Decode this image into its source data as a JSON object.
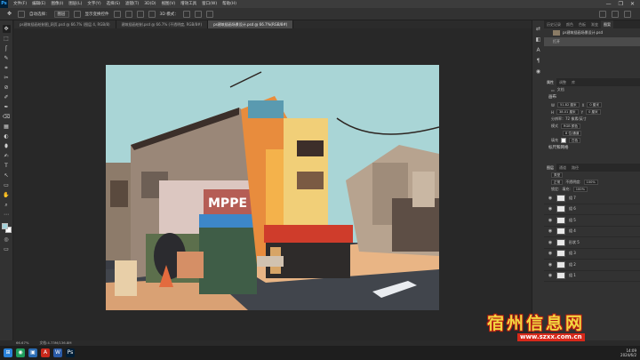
{
  "app": {
    "logo": "Ps",
    "window_controls": [
      "—",
      "❐",
      "✕"
    ]
  },
  "menubar": {
    "items": [
      "文件(F)",
      "编辑(E)",
      "图像(I)",
      "图层(L)",
      "文字(Y)",
      "选择(S)",
      "滤镜(T)",
      "3D(D)",
      "视图(V)",
      "增效工具",
      "窗口(W)",
      "帮助(H)"
    ]
  },
  "options": {
    "auto_select_label": "自动选择：",
    "auto_select_value": "图层",
    "show_transform_label": "显示变换控件",
    "mode_3d_label": "3D 模式："
  },
  "tabs": [
    {
      "label": "ps建筑插画绘制图_网页.psd @ 66.7% (图层 4, RGB/8)",
      "active": false
    },
    {
      "label": "建筑插画绘制.psd @ 66.7% (不透明度, RGB/8#)",
      "active": false
    },
    {
      "label": "ps建筑插画场景设计.psd @ 66.7%(RGB/8#)",
      "active": true
    }
  ],
  "tools": [
    "✥",
    "⬚",
    "ʃ",
    "✎",
    "⌗",
    "✂",
    "⊘",
    "✐",
    "✒",
    "⌫",
    "▦",
    "◐",
    "⬮",
    "✍",
    "T",
    "↖",
    "▭",
    "✋",
    "⌕",
    "⋯"
  ],
  "swatches": {
    "foreground": "#a2d1d9",
    "background": "#ffffff"
  },
  "right_strip_icons": [
    "⇄",
    "◧",
    "A",
    "¶",
    "◉"
  ],
  "history_panel": {
    "tabs": [
      "历史记录",
      "颜色",
      "色板",
      "渐变",
      "图案"
    ],
    "items": [
      {
        "label": "ps建筑插画场景设计.psd",
        "selected": false
      },
      {
        "label": "打开",
        "selected": true
      }
    ]
  },
  "properties_panel": {
    "tabs": [
      "属性",
      "调整",
      "库"
    ],
    "doc_label": "文档",
    "canvas_label": "画布",
    "w_label": "W",
    "w_value": "51.82 厘米",
    "h_label": "H",
    "h_value": "38.01 厘米",
    "x_label": "X",
    "x_value": "0 厘米",
    "y_label": "Y",
    "y_value": "0 厘米",
    "resolution": "分辨率：72 像素/英寸",
    "mode_label": "模式",
    "mode_value": "RGB 颜色",
    "depth_value": "8 位/通道",
    "fill_label": "填充",
    "fill_value": "白色",
    "rulers_section": "标尺和网格"
  },
  "layers_panel": {
    "tabs": [
      "图层",
      "通道",
      "路径"
    ],
    "kind_label": "类型",
    "blend_mode": "正常",
    "opacity_label": "不透明度:",
    "opacity_value": "100%",
    "lock_label": "锁定:",
    "fill_label": "填充:",
    "fill_value": "100%",
    "layers": [
      {
        "name": "组 7",
        "selected": false
      },
      {
        "name": "组 6",
        "selected": false
      },
      {
        "name": "组 5",
        "selected": false
      },
      {
        "name": "组 4",
        "selected": false
      },
      {
        "name": "形状 5",
        "selected": false
      },
      {
        "name": "组 3",
        "selected": false
      },
      {
        "name": "组 2",
        "selected": false
      },
      {
        "name": "组 1",
        "selected": false
      }
    ]
  },
  "statusbar": {
    "zoom": "66.67%",
    "doc_info": "文档:4.73M/136.8M"
  },
  "taskbar": {
    "icons": [
      {
        "glyph": "⊞",
        "color": "#2a82da"
      },
      {
        "glyph": "◉",
        "color": "#1e9d5c"
      },
      {
        "glyph": "▣",
        "color": "#2b6cb3"
      },
      {
        "glyph": "A",
        "color": "#c8281c"
      },
      {
        "glyph": "W",
        "color": "#2a5ba8"
      },
      {
        "glyph": "Ps",
        "color": "#001e36"
      }
    ],
    "time": "14:09",
    "date": "2024/6/2"
  },
  "watermark": {
    "text": "宿州信息网",
    "url": "www.szxx.com.cn"
  }
}
